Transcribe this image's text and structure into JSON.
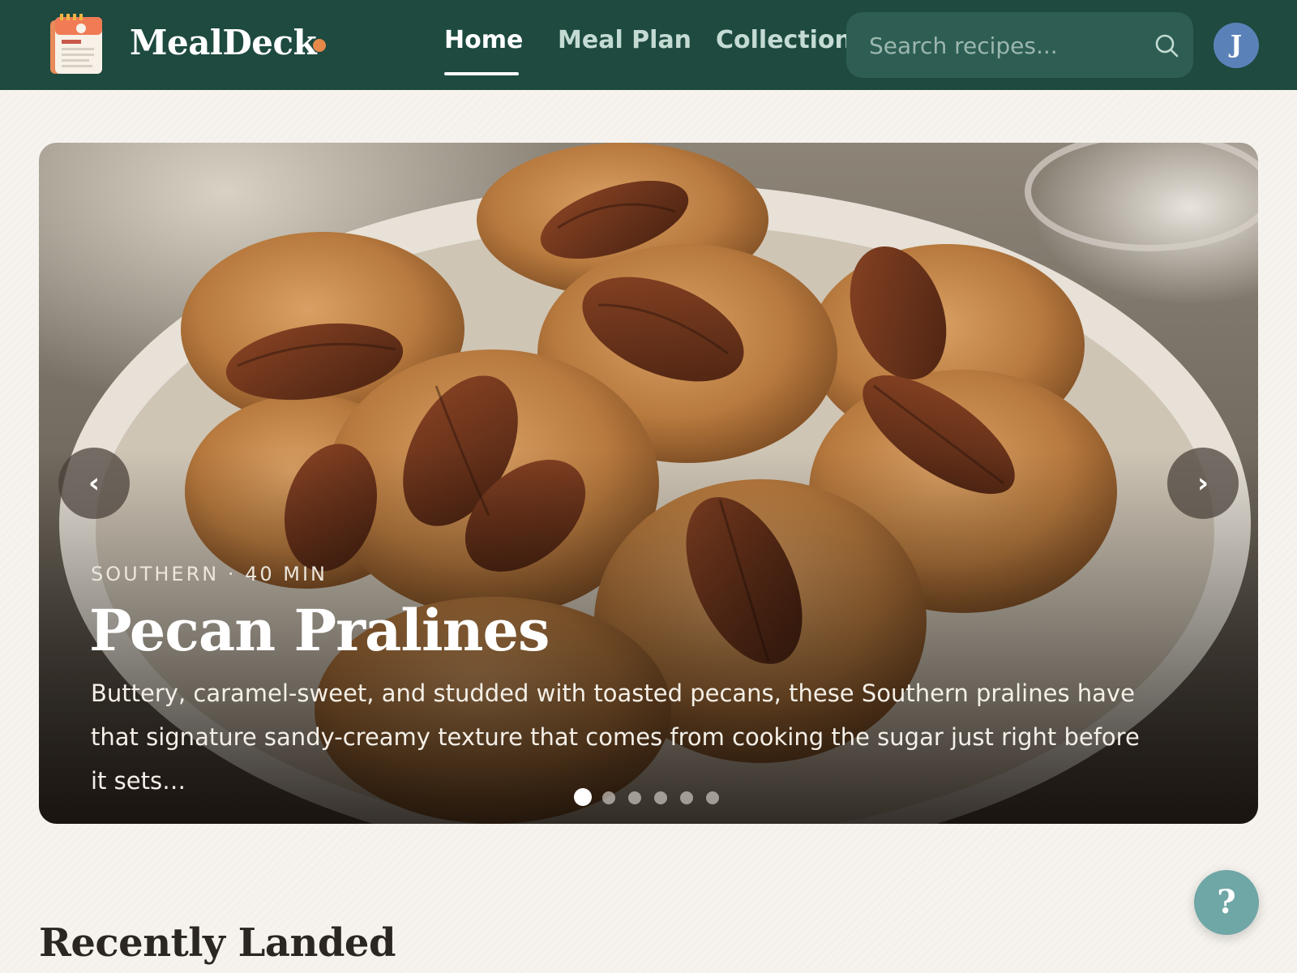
{
  "app": {
    "brand": "MealDeck",
    "logo_icon": "recipe-card-icon",
    "status_dot_color": "#e5884a",
    "header_color": "#1e4a40"
  },
  "nav": {
    "items": [
      {
        "label": "Home",
        "active": true
      },
      {
        "label": "Meal Plan",
        "active": false
      },
      {
        "label": "Collections",
        "active": false
      }
    ]
  },
  "search": {
    "placeholder": "Search recipes...",
    "value": "",
    "icon": "search-icon"
  },
  "user": {
    "avatar_initial": "J",
    "avatar_color": "#5b82b8"
  },
  "hero": {
    "meta": "SOUTHERN · 40 MIN",
    "title": "Pecan Pralines",
    "description": "Buttery, caramel-sweet, and studded with toasted pecans, these Southern pralines have that signature sandy-creamy texture that comes from cooking the sugar just right before it sets…",
    "prev_label": "‹",
    "next_label": "›",
    "slide_count": 6,
    "current_slide": 1
  },
  "help": {
    "label": "?",
    "color": "#6fa6a6"
  },
  "sections": {
    "recent_title": "Recently Landed"
  }
}
